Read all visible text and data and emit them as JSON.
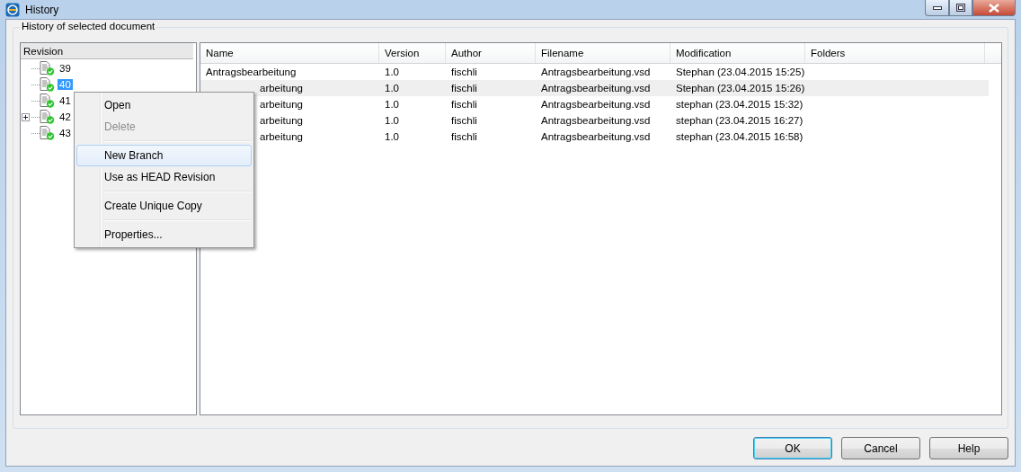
{
  "window": {
    "title": "History"
  },
  "group": {
    "title": "History of selected document"
  },
  "tree": {
    "header": "Revision",
    "items": [
      {
        "label": "39",
        "selected": false,
        "expandable": false
      },
      {
        "label": "40",
        "selected": true,
        "expandable": false
      },
      {
        "label": "41",
        "selected": false,
        "expandable": false
      },
      {
        "label": "42",
        "selected": false,
        "expandable": true
      },
      {
        "label": "43",
        "selected": false,
        "expandable": false
      }
    ]
  },
  "table": {
    "columns": [
      "Name",
      "Version",
      "Author",
      "Filename",
      "Modification",
      "Folders"
    ],
    "rows": [
      {
        "selected": false,
        "covered": false,
        "cells": [
          "Antragsbearbeitung",
          "1.0",
          "fischli",
          "Antragsbearbeitung.vsd",
          "Stephan (23.04.2015 15:25)"
        ]
      },
      {
        "selected": true,
        "covered": true,
        "cells": [
          "arbeitung",
          "1.0",
          "fischli",
          "Antragsbearbeitung.vsd",
          "Stephan (23.04.2015 15:26)"
        ]
      },
      {
        "selected": false,
        "covered": true,
        "cells": [
          "arbeitung",
          "1.0",
          "fischli",
          "Antragsbearbeitung.vsd",
          "stephan (23.04.2015 15:32)"
        ]
      },
      {
        "selected": false,
        "covered": true,
        "cells": [
          "arbeitung",
          "1.0",
          "fischli",
          "Antragsbearbeitung.vsd",
          "stephan (23.04.2015 16:27)"
        ]
      },
      {
        "selected": false,
        "covered": true,
        "cells": [
          "arbeitung",
          "1.0",
          "fischli",
          "Antragsbearbeitung.vsd",
          "stephan (23.04.2015 16:58)"
        ]
      }
    ]
  },
  "context_menu": [
    {
      "kind": "item",
      "label": "Open",
      "disabled": false,
      "selected": false
    },
    {
      "kind": "item",
      "label": "Delete",
      "disabled": true,
      "selected": false
    },
    {
      "kind": "separator"
    },
    {
      "kind": "item",
      "label": "New Branch",
      "disabled": false,
      "selected": true
    },
    {
      "kind": "item",
      "label": "Use as HEAD Revision",
      "disabled": false,
      "selected": false
    },
    {
      "kind": "separator"
    },
    {
      "kind": "item",
      "label": "Create Unique Copy",
      "disabled": false,
      "selected": false
    },
    {
      "kind": "separator"
    },
    {
      "kind": "item",
      "label": "Properties...",
      "disabled": false,
      "selected": false
    }
  ],
  "buttons": [
    {
      "label": "OK",
      "default": true
    },
    {
      "label": "Cancel",
      "default": false
    },
    {
      "label": "Help",
      "default": false
    }
  ]
}
